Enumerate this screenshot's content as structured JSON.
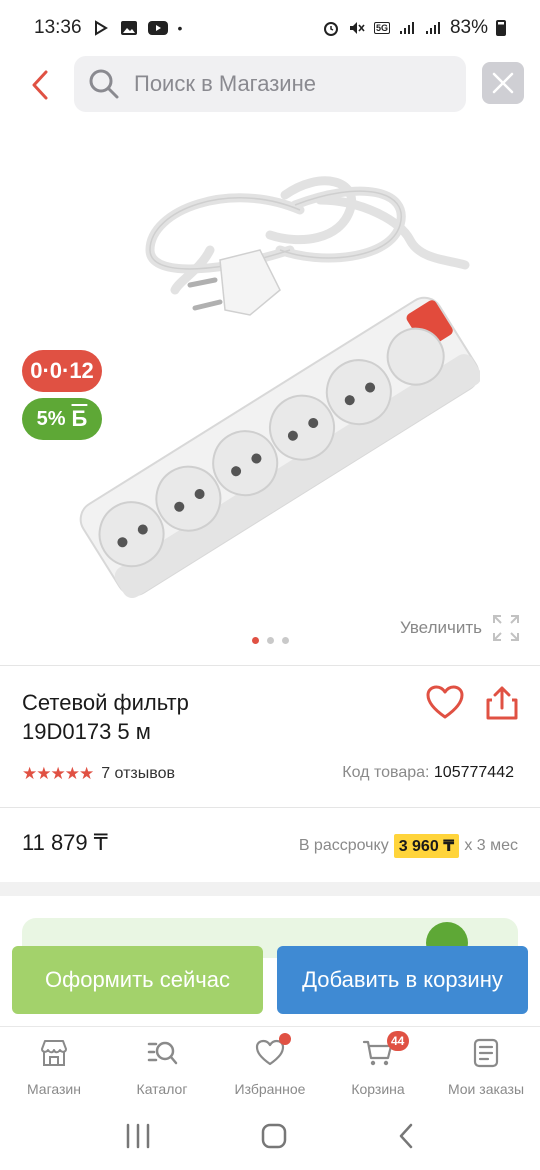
{
  "status_bar": {
    "time": "13:36",
    "battery": "83%",
    "network": "5G"
  },
  "search": {
    "placeholder": "Поиск в Магазине"
  },
  "badges": {
    "installment": "0·0·12",
    "bonus_percent": "5%",
    "bonus_symbol": "Б"
  },
  "gallery": {
    "zoom_label": "Увеличить",
    "total_images": 3,
    "current_image": 1
  },
  "product": {
    "title_line1": "Сетевой фильтр",
    "title_line2": "19D0173 5 м",
    "rating": 5,
    "reviews": "7 отзывов",
    "sku_label": "Код товара:",
    "sku_value": "105777442",
    "price": "11 879 ₸",
    "installment_label": "В рассрочку",
    "installment_amount": "3 960 ₸",
    "installment_term": "х 3 мес"
  },
  "actions": {
    "checkout": "Оформить сейчас",
    "add_to_cart": "Добавить в корзину"
  },
  "bottom_nav": {
    "items": [
      {
        "label": "Магазин",
        "icon": "store-icon"
      },
      {
        "label": "Каталог",
        "icon": "catalog-icon"
      },
      {
        "label": "Избранное",
        "icon": "heart-icon"
      },
      {
        "label": "Корзина",
        "icon": "cart-icon"
      },
      {
        "label": "Мои заказы",
        "icon": "orders-icon"
      }
    ],
    "cart_count": "44"
  },
  "colors": {
    "accent_red": "#e05143",
    "green": "#5ea836",
    "checkout_green": "#a3d26b",
    "blue": "#3f8ad3",
    "highlight_yellow": "#ffd43b"
  }
}
